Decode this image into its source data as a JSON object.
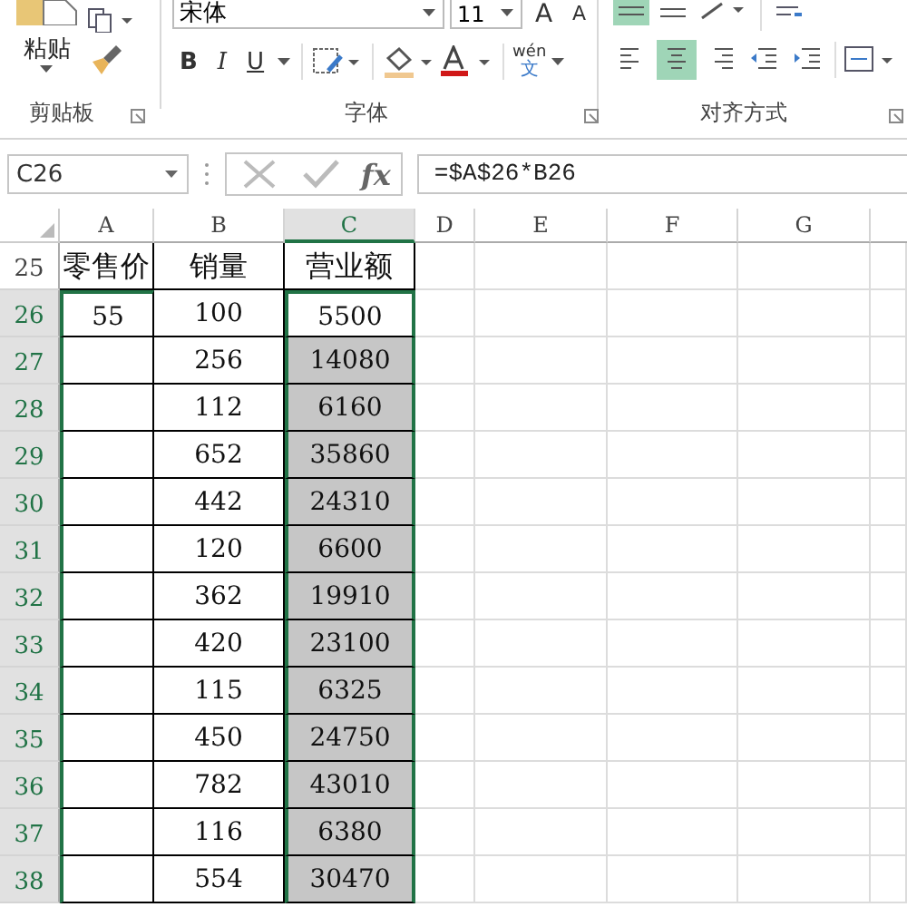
{
  "ribbon": {
    "paste_label": "粘贴",
    "font_name": "宋体",
    "font_size": "11",
    "grow_font": "A",
    "shrink_font": "A",
    "bold": "B",
    "italic": "I",
    "underline": "U",
    "phonetic_top": "wén",
    "phonetic_bottom": "文",
    "align_buttons": [
      {
        "kind": "left",
        "selected": false
      },
      {
        "kind": "center",
        "selected": true
      },
      {
        "kind": "right",
        "selected": false
      },
      {
        "kind": "outdent",
        "selected": false
      },
      {
        "kind": "indent",
        "selected": false
      }
    ],
    "top_align_selected": true,
    "groups": [
      {
        "label": "剪贴板"
      },
      {
        "label": "字体"
      },
      {
        "label": "对齐方式"
      }
    ]
  },
  "name_box": "C26",
  "fx": "fx",
  "formula": "=$A$26*B26",
  "columns": [
    {
      "label": "A",
      "selected": false
    },
    {
      "label": "B",
      "selected": false
    },
    {
      "label": "C",
      "selected": true
    },
    {
      "label": "D",
      "selected": false
    },
    {
      "label": "E",
      "selected": false
    },
    {
      "label": "F",
      "selected": false
    },
    {
      "label": "G",
      "selected": false
    }
  ],
  "rows": [
    {
      "number": "25",
      "selected": false,
      "cells": [
        "零售价",
        "销量",
        "营业额"
      ],
      "c_selected": false
    },
    {
      "number": "26",
      "selected": true,
      "cells": [
        "55",
        "100",
        "5500"
      ],
      "c_selected": false
    },
    {
      "number": "27",
      "selected": true,
      "cells": [
        "",
        "256",
        "14080"
      ],
      "c_selected": true
    },
    {
      "number": "28",
      "selected": true,
      "cells": [
        "",
        "112",
        "6160"
      ],
      "c_selected": true
    },
    {
      "number": "29",
      "selected": true,
      "cells": [
        "",
        "652",
        "35860"
      ],
      "c_selected": true
    },
    {
      "number": "30",
      "selected": true,
      "cells": [
        "",
        "442",
        "24310"
      ],
      "c_selected": true
    },
    {
      "number": "31",
      "selected": true,
      "cells": [
        "",
        "120",
        "6600"
      ],
      "c_selected": true
    },
    {
      "number": "32",
      "selected": true,
      "cells": [
        "",
        "362",
        "19910"
      ],
      "c_selected": true
    },
    {
      "number": "33",
      "selected": true,
      "cells": [
        "",
        "420",
        "23100"
      ],
      "c_selected": true
    },
    {
      "number": "34",
      "selected": true,
      "cells": [
        "",
        "115",
        "6325"
      ],
      "c_selected": true
    },
    {
      "number": "35",
      "selected": true,
      "cells": [
        "",
        "450",
        "24750"
      ],
      "c_selected": true
    },
    {
      "number": "36",
      "selected": true,
      "cells": [
        "",
        "782",
        "43010"
      ],
      "c_selected": true
    },
    {
      "number": "37",
      "selected": true,
      "cells": [
        "",
        "116",
        "6380"
      ],
      "c_selected": true
    },
    {
      "number": "38",
      "selected": true,
      "cells": [
        "",
        "554",
        "30470"
      ],
      "c_selected": true
    }
  ]
}
